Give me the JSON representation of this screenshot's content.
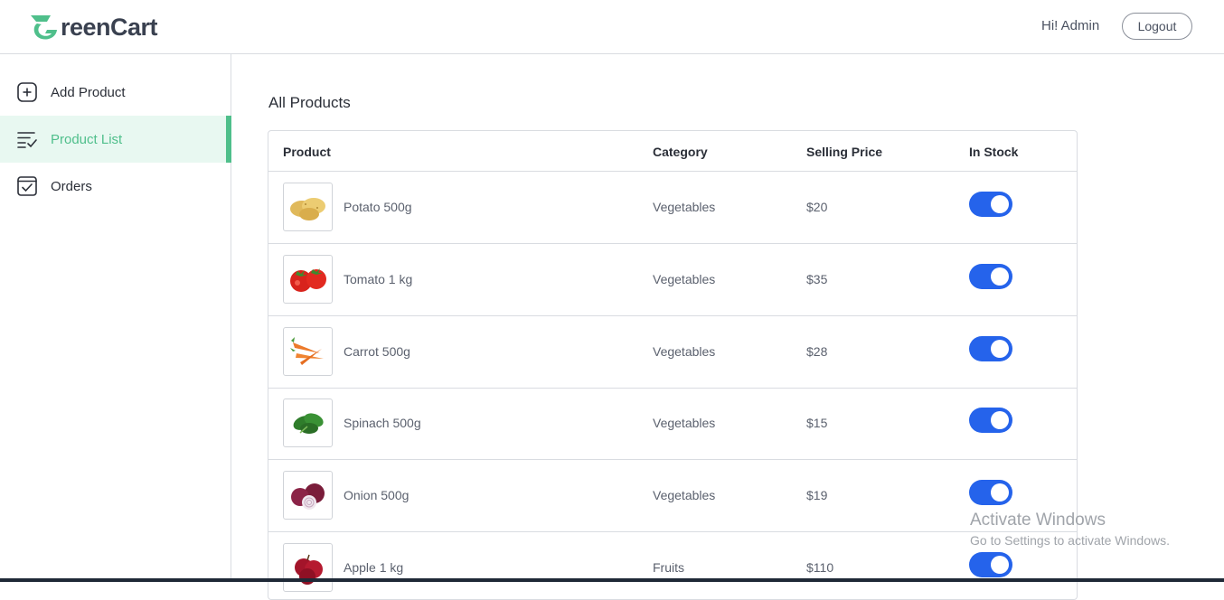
{
  "header": {
    "logo_text": "reenCart",
    "greeting": "Hi! Admin",
    "logout_label": "Logout"
  },
  "sidebar": {
    "items": [
      {
        "label": "Add Product",
        "icon": "add-square-icon",
        "active": false
      },
      {
        "label": "Product List",
        "icon": "list-check-icon",
        "active": true
      },
      {
        "label": "Orders",
        "icon": "checkbox-icon",
        "active": false
      }
    ]
  },
  "main": {
    "title": "All Products",
    "columns": [
      "Product",
      "Category",
      "Selling Price",
      "In Stock"
    ],
    "rows": [
      {
        "name": "Potato 500g",
        "category": "Vegetables",
        "price": "$20",
        "in_stock": true,
        "image": "potato-image"
      },
      {
        "name": "Tomato 1 kg",
        "category": "Vegetables",
        "price": "$35",
        "in_stock": true,
        "image": "tomato-image"
      },
      {
        "name": "Carrot 500g",
        "category": "Vegetables",
        "price": "$28",
        "in_stock": true,
        "image": "carrot-image"
      },
      {
        "name": "Spinach 500g",
        "category": "Vegetables",
        "price": "$15",
        "in_stock": true,
        "image": "spinach-image"
      },
      {
        "name": "Onion 500g",
        "category": "Vegetables",
        "price": "$19",
        "in_stock": true,
        "image": "onion-image"
      },
      {
        "name": "Apple 1 kg",
        "category": "Fruits",
        "price": "$110",
        "in_stock": true,
        "image": "apple-image"
      }
    ]
  },
  "watermark": {
    "line1": "Activate Windows",
    "line2": "Go to Settings to activate Windows."
  },
  "colors": {
    "brand": "#4fbf8b",
    "active_bg": "#e8f8f1",
    "toggle_on": "#2563eb"
  }
}
